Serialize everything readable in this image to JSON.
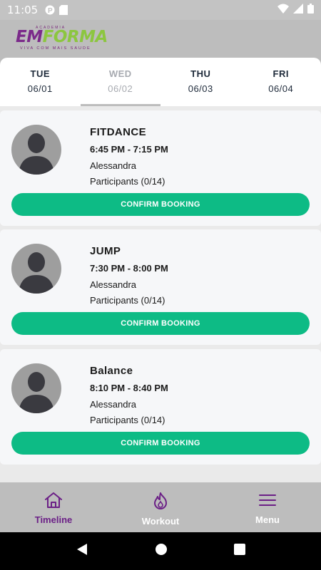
{
  "status_bar": {
    "time": "11:05"
  },
  "header": {
    "logo_top": "ACADEMIA",
    "logo_em": "EM",
    "logo_main": "FORMA",
    "logo_sub": "VIVA COM MAIS SAUDE"
  },
  "days": [
    {
      "name": "TUE",
      "date": "06/01"
    },
    {
      "name": "WED",
      "date": "06/02",
      "active": true
    },
    {
      "name": "THU",
      "date": "06/03"
    },
    {
      "name": "FRI",
      "date": "06/04"
    }
  ],
  "classes": [
    {
      "name": "FITDANCE",
      "time": "6:45 PM - 7:15 PM",
      "trainer": "Alessandra",
      "participants": "Participants (0/14)",
      "button": "CONFIRM BOOKING"
    },
    {
      "name": "JUMP",
      "time": "7:30 PM - 8:00 PM",
      "trainer": "Alessandra",
      "participants": "Participants (0/14)",
      "button": "CONFIRM BOOKING"
    },
    {
      "name": "Balance",
      "time": "8:10 PM - 8:40 PM",
      "trainer": "Alessandra",
      "participants": "Participants (0/14)",
      "button": "CONFIRM BOOKING"
    }
  ],
  "bottom_nav": [
    {
      "label": "Timeline",
      "icon": "home-icon",
      "active": true
    },
    {
      "label": "Workout",
      "icon": "flame-icon"
    },
    {
      "label": "Menu",
      "icon": "menu-icon"
    }
  ],
  "colors": {
    "accent": "#0dbb85",
    "brand_purple": "#6b1f86",
    "brand_green": "#8cc63f"
  }
}
